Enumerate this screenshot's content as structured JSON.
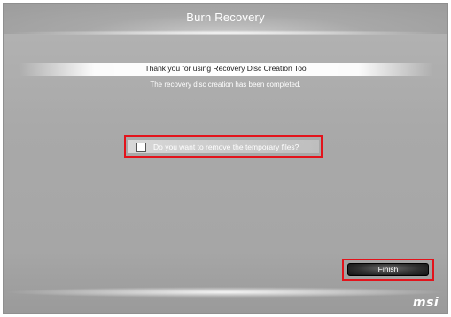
{
  "window": {
    "title": "Burn Recovery",
    "banner_text": "Thank you for using Recovery Disc Creation Tool",
    "status_text": "The recovery disc creation has been completed."
  },
  "options": {
    "remove_temp_files_label": "Do you want to remove the temporary files?",
    "remove_temp_files_checked": false
  },
  "actions": {
    "finish_label": "Finish"
  },
  "branding": {
    "logo_text": "msi"
  },
  "colors": {
    "highlight": "#e3131b",
    "background": "#aaaaaa",
    "button": "#222222"
  }
}
